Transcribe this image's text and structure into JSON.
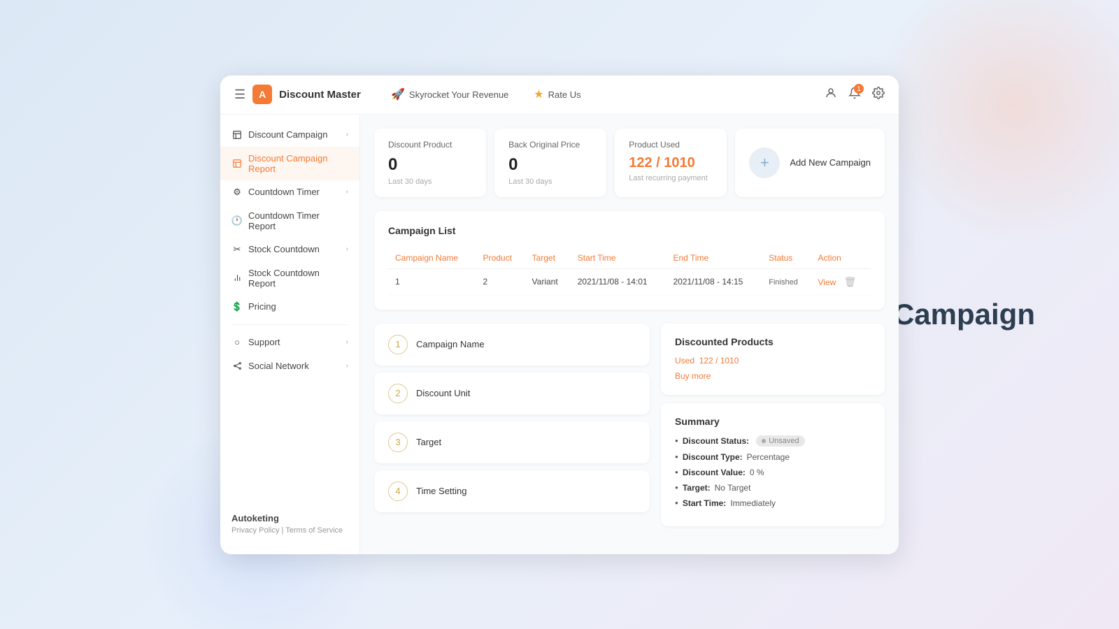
{
  "header": {
    "hamburger": "≡",
    "logo_letter": "A",
    "app_title": "Discount Master",
    "nav_items": [
      {
        "icon": "🚀",
        "label": "Skyrocket Your Revenue"
      },
      {
        "icon": "⭐",
        "label": "Rate Us"
      }
    ],
    "notification_count": "1"
  },
  "sidebar": {
    "items": [
      {
        "id": "discount-campaign",
        "label": "Discount Campaign",
        "icon": "🏷",
        "has_chevron": true,
        "active": false
      },
      {
        "id": "discount-campaign-report",
        "label": "Discount Campaign Report",
        "icon": "📋",
        "has_chevron": false,
        "active": true
      },
      {
        "id": "countdown-timer",
        "label": "Countdown Timer",
        "icon": "⚙",
        "has_chevron": true,
        "active": false
      },
      {
        "id": "countdown-timer-report",
        "label": "Countdown Timer Report",
        "icon": "🕐",
        "has_chevron": false,
        "active": false
      },
      {
        "id": "stock-countdown",
        "label": "Stock Countdown",
        "icon": "✂",
        "has_chevron": true,
        "active": false
      },
      {
        "id": "stock-countdown-report",
        "label": "Stock Countdown Report",
        "icon": "📊",
        "has_chevron": false,
        "active": false
      },
      {
        "id": "pricing",
        "label": "Pricing",
        "icon": "💲",
        "has_chevron": false,
        "active": false
      }
    ],
    "bottom_items": [
      {
        "id": "support",
        "label": "Support",
        "icon": "○",
        "has_chevron": true
      },
      {
        "id": "social-network",
        "label": "Social Network",
        "icon": "📡",
        "has_chevron": true
      }
    ],
    "brand": "Autoketing",
    "privacy_policy": "Privacy Policy",
    "terms_of_service": "Terms of Service",
    "separator": "|"
  },
  "stats": {
    "discount_product": {
      "label": "Discount Product",
      "value": "0",
      "sublabel": "Last 30 days"
    },
    "back_original_price": {
      "label": "Back Original Price",
      "value": "0",
      "sublabel": "Last 30 days"
    },
    "product_used": {
      "label": "Product Used",
      "value": "122 / 1010",
      "sublabel": "Last recurring payment"
    },
    "add_campaign": {
      "label": "Add New Campaign",
      "btn_icon": "+"
    }
  },
  "campaign_list": {
    "title": "Campaign List",
    "columns": [
      "Campaign Name",
      "Product",
      "Target",
      "Start Time",
      "End Time",
      "Status",
      "Action"
    ],
    "rows": [
      {
        "name": "1",
        "product": "2",
        "target": "Variant",
        "start_time": "2021/11/08 - 14:01",
        "end_time": "2021/11/08 - 14:15",
        "status": "Finished",
        "action_view": "View",
        "action_delete": "🗑"
      }
    ]
  },
  "form_steps": [
    {
      "number": "1",
      "label": "Campaign Name"
    },
    {
      "number": "2",
      "label": "Discount Unit"
    },
    {
      "number": "3",
      "label": "Target"
    },
    {
      "number": "4",
      "label": "Time Setting"
    }
  ],
  "discounted_products": {
    "title": "Discounted Products",
    "used_label": "Used",
    "used_value": "122 / 1010",
    "buy_more_label": "Buy more"
  },
  "summary": {
    "title": "Summary",
    "items": [
      {
        "label": "Discount Status:",
        "value": "Unsaved",
        "is_badge": true
      },
      {
        "label": "Discount Type:",
        "value": "Percentage"
      },
      {
        "label": "Discount Value:",
        "value": "0 %"
      },
      {
        "label": "Target:",
        "value": "No Target"
      },
      {
        "label": "Start Time:",
        "value": "Immediately"
      }
    ]
  },
  "page_title": "Discount Campaign"
}
